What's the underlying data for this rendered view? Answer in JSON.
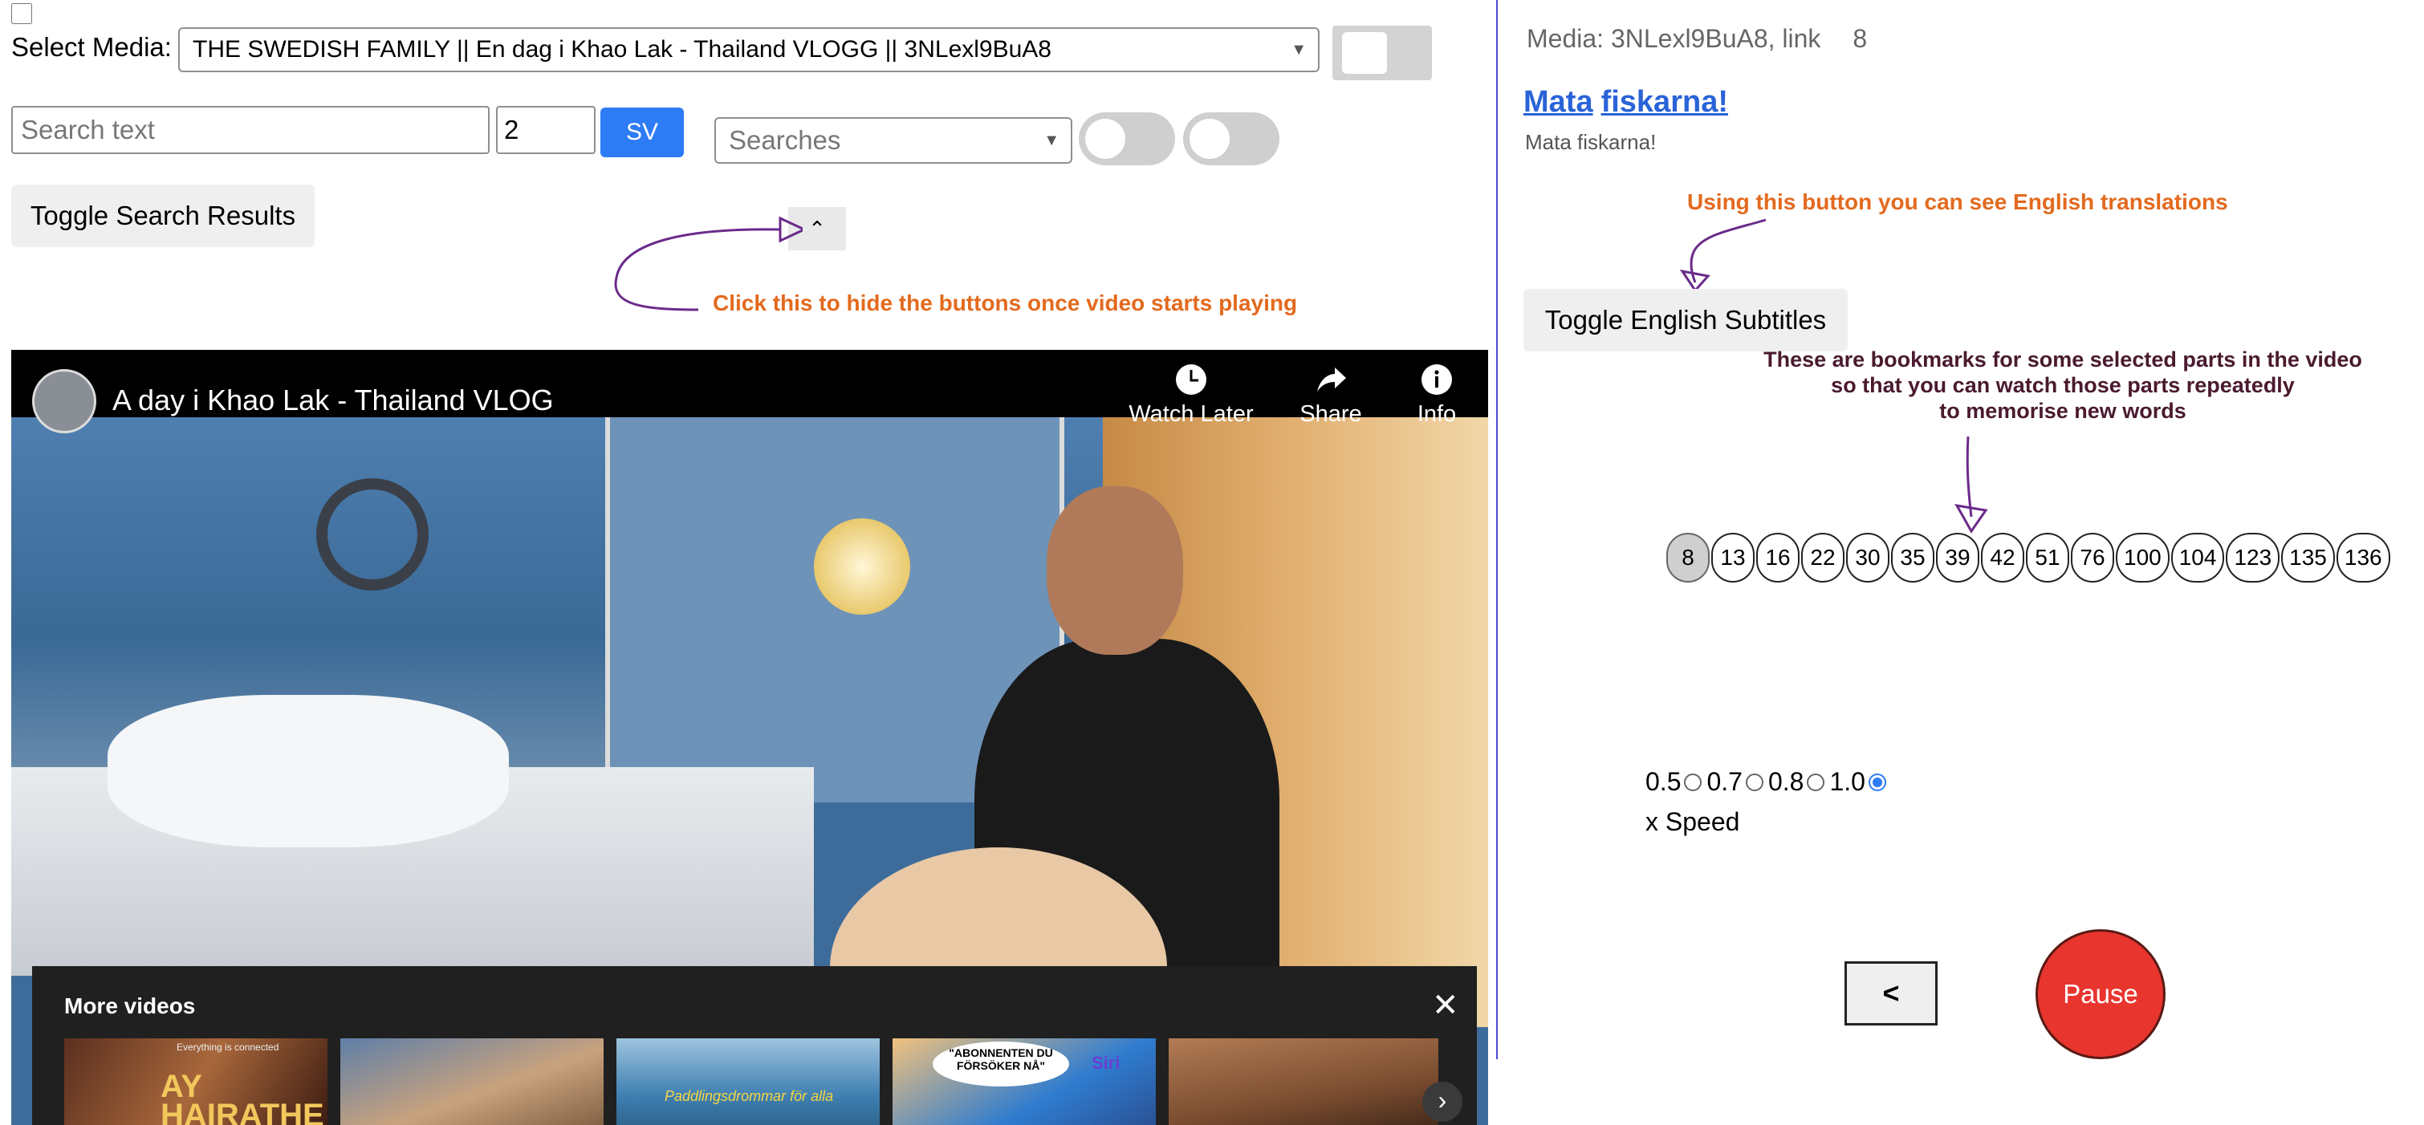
{
  "controls": {
    "select_media_label": "Select Media:",
    "selected_media": "THE SWEDISH FAMILY || En dag i Khao Lak - Thailand VLOGG || 3NLexl9BuA8",
    "search_placeholder": "Search text",
    "count_value": "2",
    "sv_button": "SV",
    "searches_placeholder": "Searches",
    "toggle_search_results": "Toggle Search Results",
    "collapse_glyph": "⌃",
    "hide_buttons_hint": "Click this to hide the buttons once video starts playing"
  },
  "video": {
    "title": "A day i Khao Lak - Thailand VLOG",
    "watch_later": "Watch Later",
    "share": "Share",
    "info": "Info",
    "more_videos_title": "More videos",
    "close_glyph": "✕",
    "next_glyph": "›",
    "thumbnails": [
      {
        "top_text": "Everything is connected",
        "big_text": "AY\nHAIRATHE"
      },
      {},
      {
        "text": "Paddlingsdrommar för alla"
      },
      {
        "bubble": "\"ABONNENTEN DU FÖRSÖKER NÅ\"",
        "siri": "Siri"
      },
      {}
    ]
  },
  "panel": {
    "media_info": "Media: 3NLexl9BuA8, link",
    "media_count": "8",
    "sentence_words": [
      "Mata",
      "fiskarna!"
    ],
    "sentence_plain": "Mata fiskarna!",
    "english_hint": "Using this button you can see English translations",
    "toggle_english": "Toggle English Subtitles",
    "bookmarks_hint_lines": [
      "These are bookmarks for some selected parts in the video",
      "so that you can watch those parts repeatedly",
      "to memorise new words"
    ],
    "bookmarks": [
      "8",
      "13",
      "16",
      "22",
      "30",
      "35",
      "39",
      "42",
      "51",
      "76",
      "100",
      "104",
      "123",
      "135",
      "136"
    ],
    "active_bookmark": "8",
    "speed_options": [
      "0.5",
      "0.7",
      "0.8",
      "1.0"
    ],
    "selected_speed": "1.0",
    "speed_label": "x Speed",
    "back_label": "<",
    "pause_label": "Pause"
  },
  "colors": {
    "accent_blue": "#2d7cf6",
    "hint_orange": "#e36a1e",
    "link_blue": "#2a63d8",
    "pause_red": "#e8352e",
    "divider": "#4a4ad8"
  }
}
